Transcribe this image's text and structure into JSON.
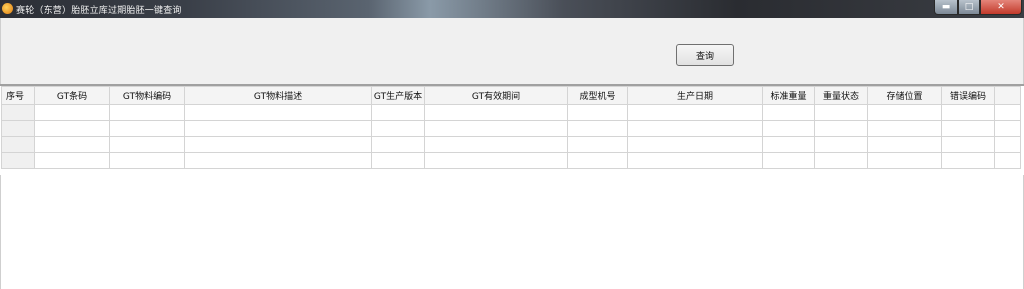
{
  "window": {
    "title": "赛轮（东营）胎胚立库过期胎胚一键查询",
    "minimize_symbol": "▬",
    "maximize_symbol": "□",
    "close_symbol": "✕"
  },
  "toolbar": {
    "query_label": "查询"
  },
  "grid": {
    "columns": [
      "序号",
      "GT条码",
      "GT物料编码",
      "GT物料描述",
      "GT生产版本",
      "GT有效期间",
      "成型机号",
      "生产日期",
      "标准重量",
      "重量状态",
      "存储位置",
      "错误编码"
    ],
    "rows": [
      [
        "",
        "",
        "",
        "",
        "",
        "",
        "",
        "",
        "",
        "",
        "",
        ""
      ],
      [
        "",
        "",
        "",
        "",
        "",
        "",
        "",
        "",
        "",
        "",
        "",
        ""
      ],
      [
        "",
        "",
        "",
        "",
        "",
        "",
        "",
        "",
        "",
        "",
        "",
        ""
      ],
      [
        "",
        "",
        "",
        "",
        "",
        "",
        "",
        "",
        "",
        "",
        "",
        ""
      ]
    ]
  }
}
